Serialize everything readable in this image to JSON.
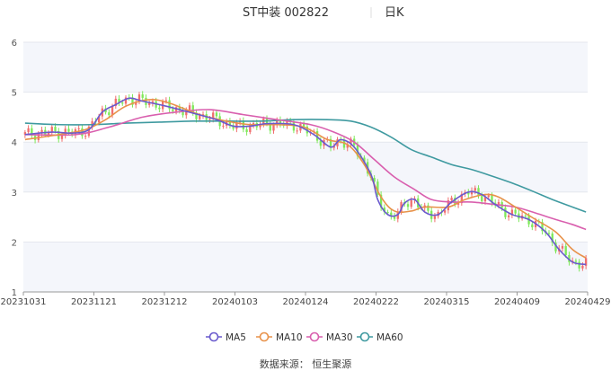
{
  "chart_data": {
    "type": "candlestick",
    "title": "ST中装 002822",
    "period": "日K",
    "source": "数据来源： 恒生聚源",
    "y_ticks": [
      1,
      2,
      3,
      4,
      5,
      6
    ],
    "ylim": [
      1,
      6
    ],
    "x_ticks": [
      "20231031",
      "20231121",
      "20231212",
      "20240103",
      "20240124",
      "20240222",
      "20240315",
      "20240409",
      "20240429"
    ],
    "legend": [
      "MA5",
      "MA10",
      "MA30",
      "MA60"
    ],
    "colors": {
      "up": "#f06e6e",
      "down": "#7ee85a",
      "MA5": "#6a5acd",
      "MA10": "#e8924a",
      "MA30": "#d95fae",
      "MA60": "#3f9aa0",
      "band": "#f4f6fb",
      "grid": "#e4e7ee"
    },
    "series": [
      {
        "name": "MA5",
        "points": [
          [
            0,
            4.15
          ],
          [
            8,
            4.2
          ],
          [
            14,
            4.18
          ],
          [
            19,
            4.25
          ],
          [
            23,
            4.6
          ],
          [
            27,
            4.75
          ],
          [
            31,
            4.88
          ],
          [
            35,
            4.82
          ],
          [
            42,
            4.72
          ],
          [
            50,
            4.58
          ],
          [
            57,
            4.45
          ],
          [
            62,
            4.32
          ],
          [
            67,
            4.32
          ],
          [
            72,
            4.37
          ],
          [
            80,
            4.35
          ],
          [
            86,
            4.15
          ],
          [
            91,
            3.9
          ],
          [
            94,
            4.05
          ],
          [
            98,
            3.9
          ],
          [
            103,
            3.35
          ],
          [
            105,
            2.85
          ],
          [
            108,
            2.55
          ],
          [
            111,
            2.55
          ],
          [
            113,
            2.78
          ],
          [
            116,
            2.85
          ],
          [
            119,
            2.6
          ],
          [
            123,
            2.55
          ],
          [
            127,
            2.8
          ],
          [
            132,
            3.0
          ],
          [
            136,
            2.95
          ],
          [
            140,
            2.75
          ],
          [
            145,
            2.55
          ],
          [
            150,
            2.45
          ],
          [
            155,
            2.2
          ],
          [
            159,
            1.85
          ],
          [
            163,
            1.6
          ],
          [
            167,
            1.55
          ]
        ]
      },
      {
        "name": "MA10",
        "points": [
          [
            0,
            4.05
          ],
          [
            10,
            4.15
          ],
          [
            18,
            4.25
          ],
          [
            24,
            4.45
          ],
          [
            30,
            4.72
          ],
          [
            37,
            4.85
          ],
          [
            43,
            4.78
          ],
          [
            52,
            4.55
          ],
          [
            60,
            4.42
          ],
          [
            67,
            4.35
          ],
          [
            75,
            4.35
          ],
          [
            83,
            4.3
          ],
          [
            90,
            4.05
          ],
          [
            96,
            3.95
          ],
          [
            101,
            3.55
          ],
          [
            106,
            2.9
          ],
          [
            110,
            2.62
          ],
          [
            115,
            2.62
          ],
          [
            119,
            2.7
          ],
          [
            126,
            2.7
          ],
          [
            131,
            2.85
          ],
          [
            137,
            2.95
          ],
          [
            141,
            2.9
          ],
          [
            146,
            2.7
          ],
          [
            152,
            2.45
          ],
          [
            158,
            2.2
          ],
          [
            163,
            1.85
          ],
          [
            167,
            1.68
          ]
        ]
      },
      {
        "name": "MA30",
        "points": [
          [
            0,
            4.15
          ],
          [
            15,
            4.15
          ],
          [
            25,
            4.3
          ],
          [
            35,
            4.5
          ],
          [
            45,
            4.6
          ],
          [
            55,
            4.65
          ],
          [
            65,
            4.55
          ],
          [
            75,
            4.45
          ],
          [
            85,
            4.35
          ],
          [
            92,
            4.2
          ],
          [
            98,
            4.0
          ],
          [
            104,
            3.65
          ],
          [
            110,
            3.3
          ],
          [
            116,
            3.05
          ],
          [
            121,
            2.85
          ],
          [
            127,
            2.8
          ],
          [
            133,
            2.8
          ],
          [
            140,
            2.75
          ],
          [
            146,
            2.7
          ],
          [
            152,
            2.58
          ],
          [
            158,
            2.45
          ],
          [
            163,
            2.35
          ],
          [
            167,
            2.25
          ]
        ]
      },
      {
        "name": "MA60",
        "points": [
          [
            0,
            4.38
          ],
          [
            10,
            4.35
          ],
          [
            20,
            4.35
          ],
          [
            30,
            4.38
          ],
          [
            40,
            4.4
          ],
          [
            50,
            4.42
          ],
          [
            60,
            4.42
          ],
          [
            70,
            4.42
          ],
          [
            80,
            4.45
          ],
          [
            90,
            4.45
          ],
          [
            97,
            4.42
          ],
          [
            103,
            4.3
          ],
          [
            109,
            4.1
          ],
          [
            115,
            3.85
          ],
          [
            121,
            3.7
          ],
          [
            127,
            3.55
          ],
          [
            133,
            3.45
          ],
          [
            139,
            3.32
          ],
          [
            145,
            3.18
          ],
          [
            151,
            3.02
          ],
          [
            157,
            2.85
          ],
          [
            163,
            2.7
          ],
          [
            167,
            2.6
          ]
        ]
      }
    ]
  }
}
